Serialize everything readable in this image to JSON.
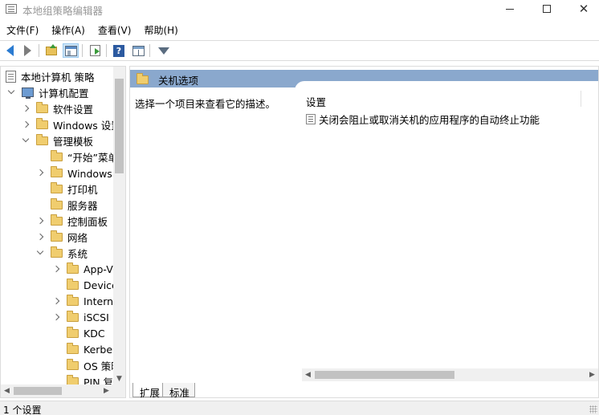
{
  "window": {
    "title": "本地组策略编辑器",
    "minimize_label": "",
    "maximize_label": "",
    "close_label": "✕"
  },
  "menu": [
    {
      "label": "文件(F)"
    },
    {
      "label": "操作(A)"
    },
    {
      "label": "查看(V)"
    },
    {
      "label": "帮助(H)"
    }
  ],
  "toolbar": {
    "help_glyph": "?"
  },
  "tree": {
    "items": [
      {
        "label": "本地计算机 策略"
      },
      {
        "label": "计算机配置"
      },
      {
        "label": "软件设置"
      },
      {
        "label": "Windows 设置"
      },
      {
        "label": "管理模板"
      },
      {
        "label": "“开始”菜单"
      },
      {
        "label": "Windows 组件"
      },
      {
        "label": "打印机"
      },
      {
        "label": "服务器"
      },
      {
        "label": "控制面板"
      },
      {
        "label": "网络"
      },
      {
        "label": "系统"
      },
      {
        "label": "App-V"
      },
      {
        "label": "Device"
      },
      {
        "label": "Internet"
      },
      {
        "label": "iSCSI"
      },
      {
        "label": "KDC"
      },
      {
        "label": "Kerberos"
      },
      {
        "label": "OS 策略"
      },
      {
        "label": "PIN 复杂性"
      }
    ]
  },
  "content": {
    "header_title": "关机选项",
    "description": "选择一个项目来查看它的描述。",
    "column_header": "设置",
    "settings": [
      {
        "label": "关闭会阻止或取消关机的应用程序的自动终止功能"
      }
    ]
  },
  "tabs": [
    {
      "label": "扩展"
    },
    {
      "label": "标准"
    }
  ],
  "status": {
    "text": "1 个设置"
  },
  "colors": {
    "header_band": "#8aa8cd",
    "folder": "#f0cd6e",
    "accent": "#2b7bd1"
  }
}
